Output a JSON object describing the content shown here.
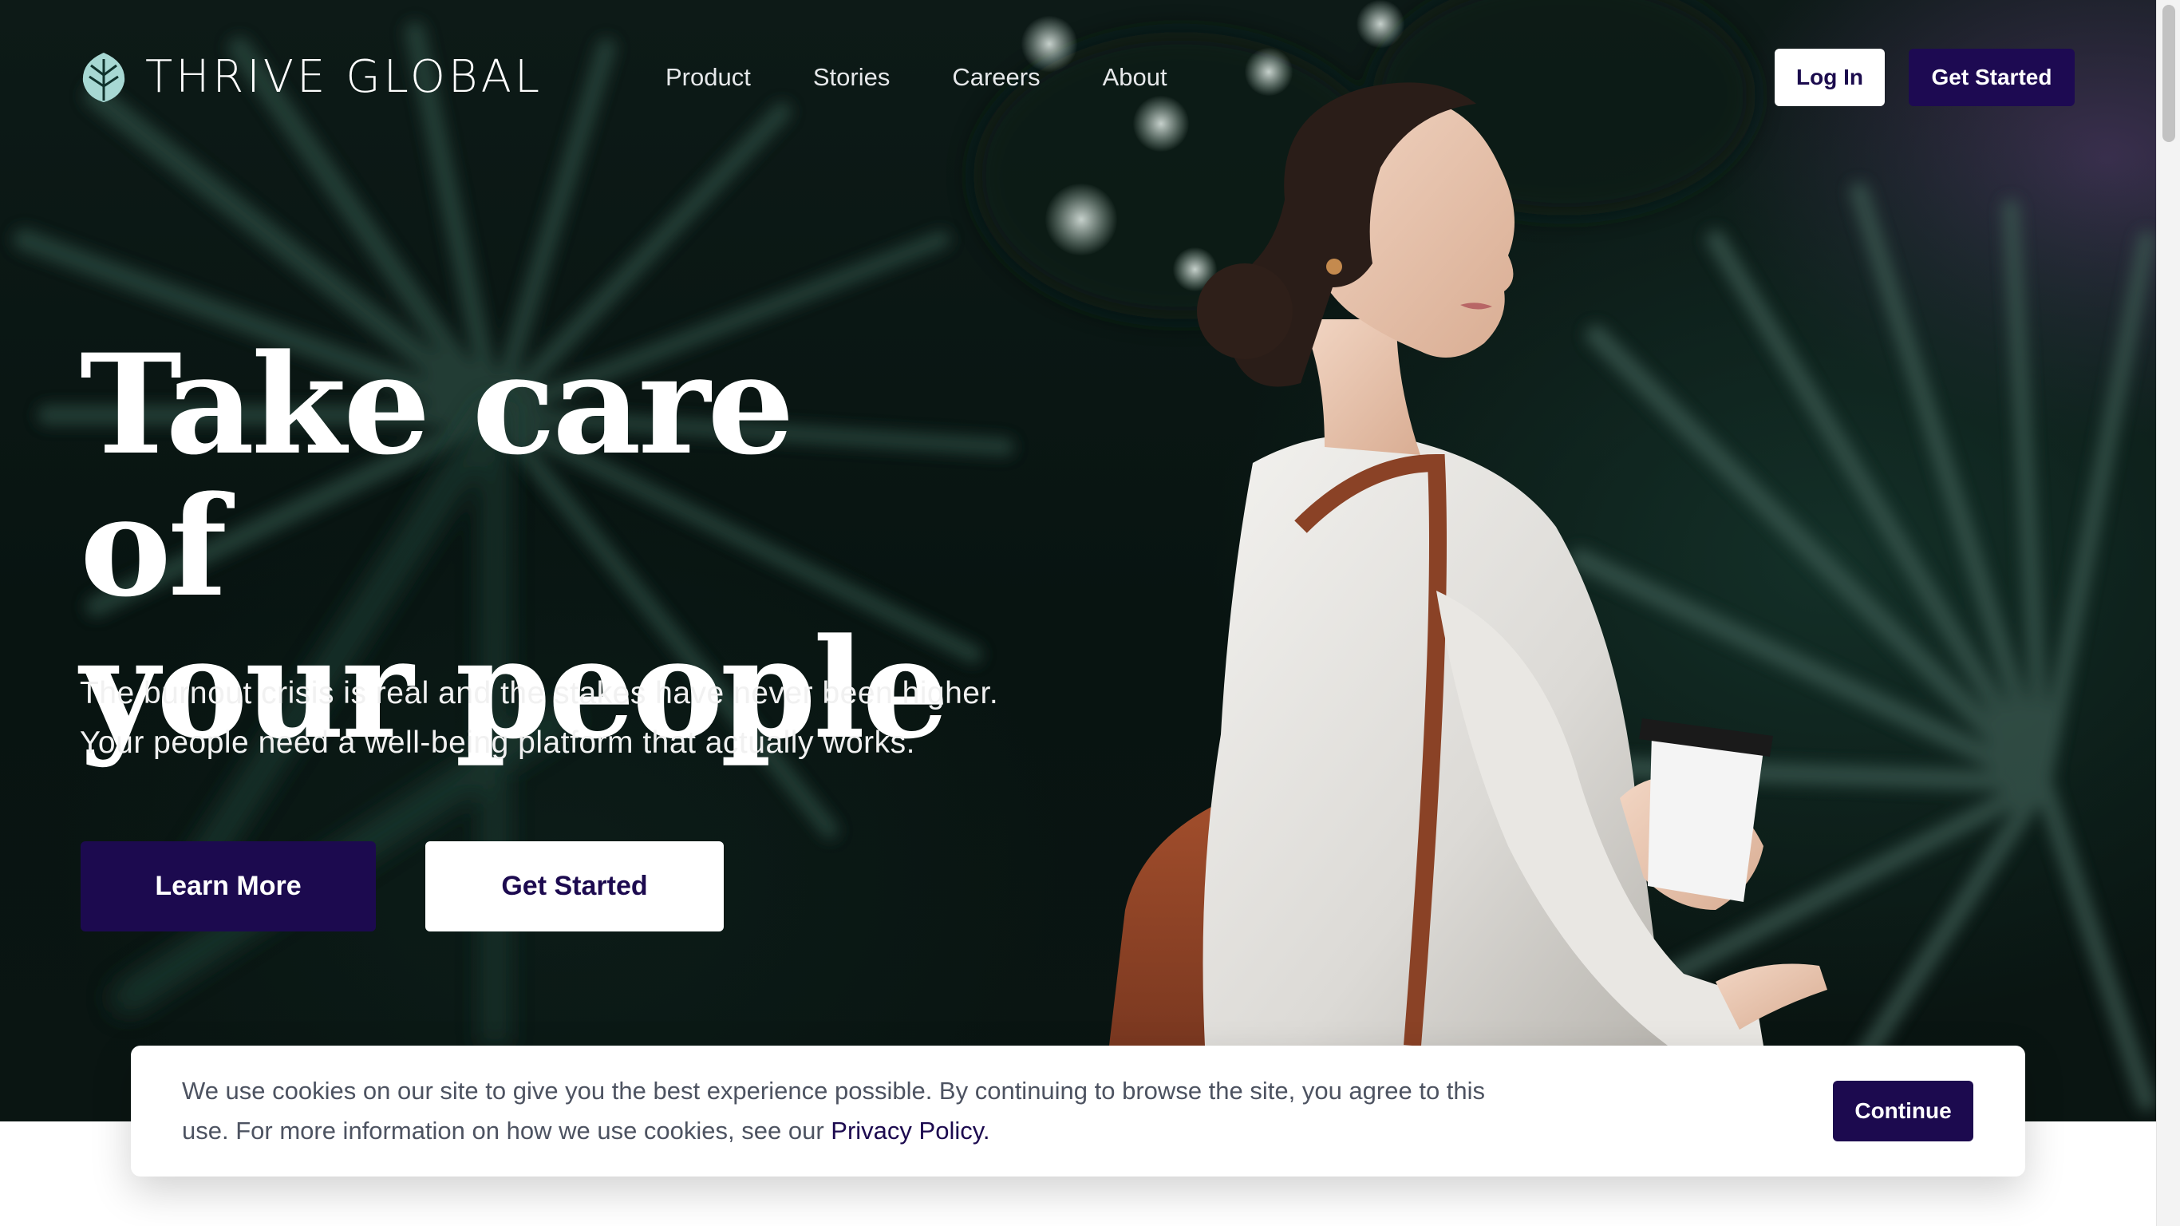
{
  "brand": {
    "name": "THRIVE GLOBAL",
    "accent_color": "#1c0a4f",
    "logo_icon": "leaf-icon",
    "logo_icon_color": "#9ed3cf"
  },
  "header": {
    "nav": [
      {
        "label": "Product"
      },
      {
        "label": "Stories"
      },
      {
        "label": "Careers"
      },
      {
        "label": "About"
      }
    ],
    "login_label": "Log In",
    "get_started_label": "Get Started"
  },
  "hero": {
    "headline_line1": "Take care of",
    "headline_line2": "your people",
    "subcopy_line1": "The burnout crisis is real and the stakes have never been higher.",
    "subcopy_line2": "Your people need a well-being platform that actually works.",
    "learn_more_label": "Learn More",
    "get_started_label": "Get Started"
  },
  "cookie_banner": {
    "text": "We use cookies on our site to give you the best experience possible. By continuing to browse the site, you agree to this use. For more information on how we use cookies, see our ",
    "link_label": "Privacy Policy.",
    "continue_label": "Continue"
  }
}
